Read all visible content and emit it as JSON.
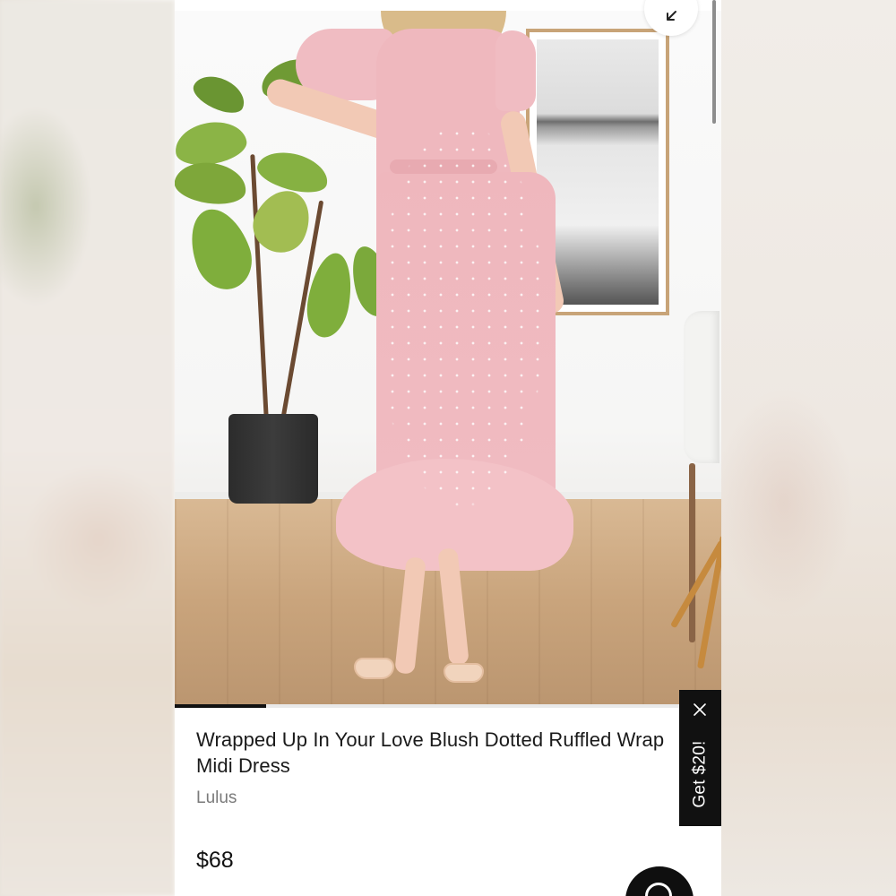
{
  "product": {
    "title": "Wrapped Up In Your Love Blush Dotted Ruffled Wrap Midi Dress",
    "brand": "Lulus",
    "price": "$68"
  },
  "gallery": {
    "image_progress_fraction": 0.167,
    "minimize_icon": "arrow-down-left-icon"
  },
  "promo": {
    "label": "Get $20!",
    "close_icon": "close-icon"
  },
  "chat": {
    "icon": "chat-icon"
  },
  "colors": {
    "accent": "#111111",
    "dress": "#efb8be"
  }
}
